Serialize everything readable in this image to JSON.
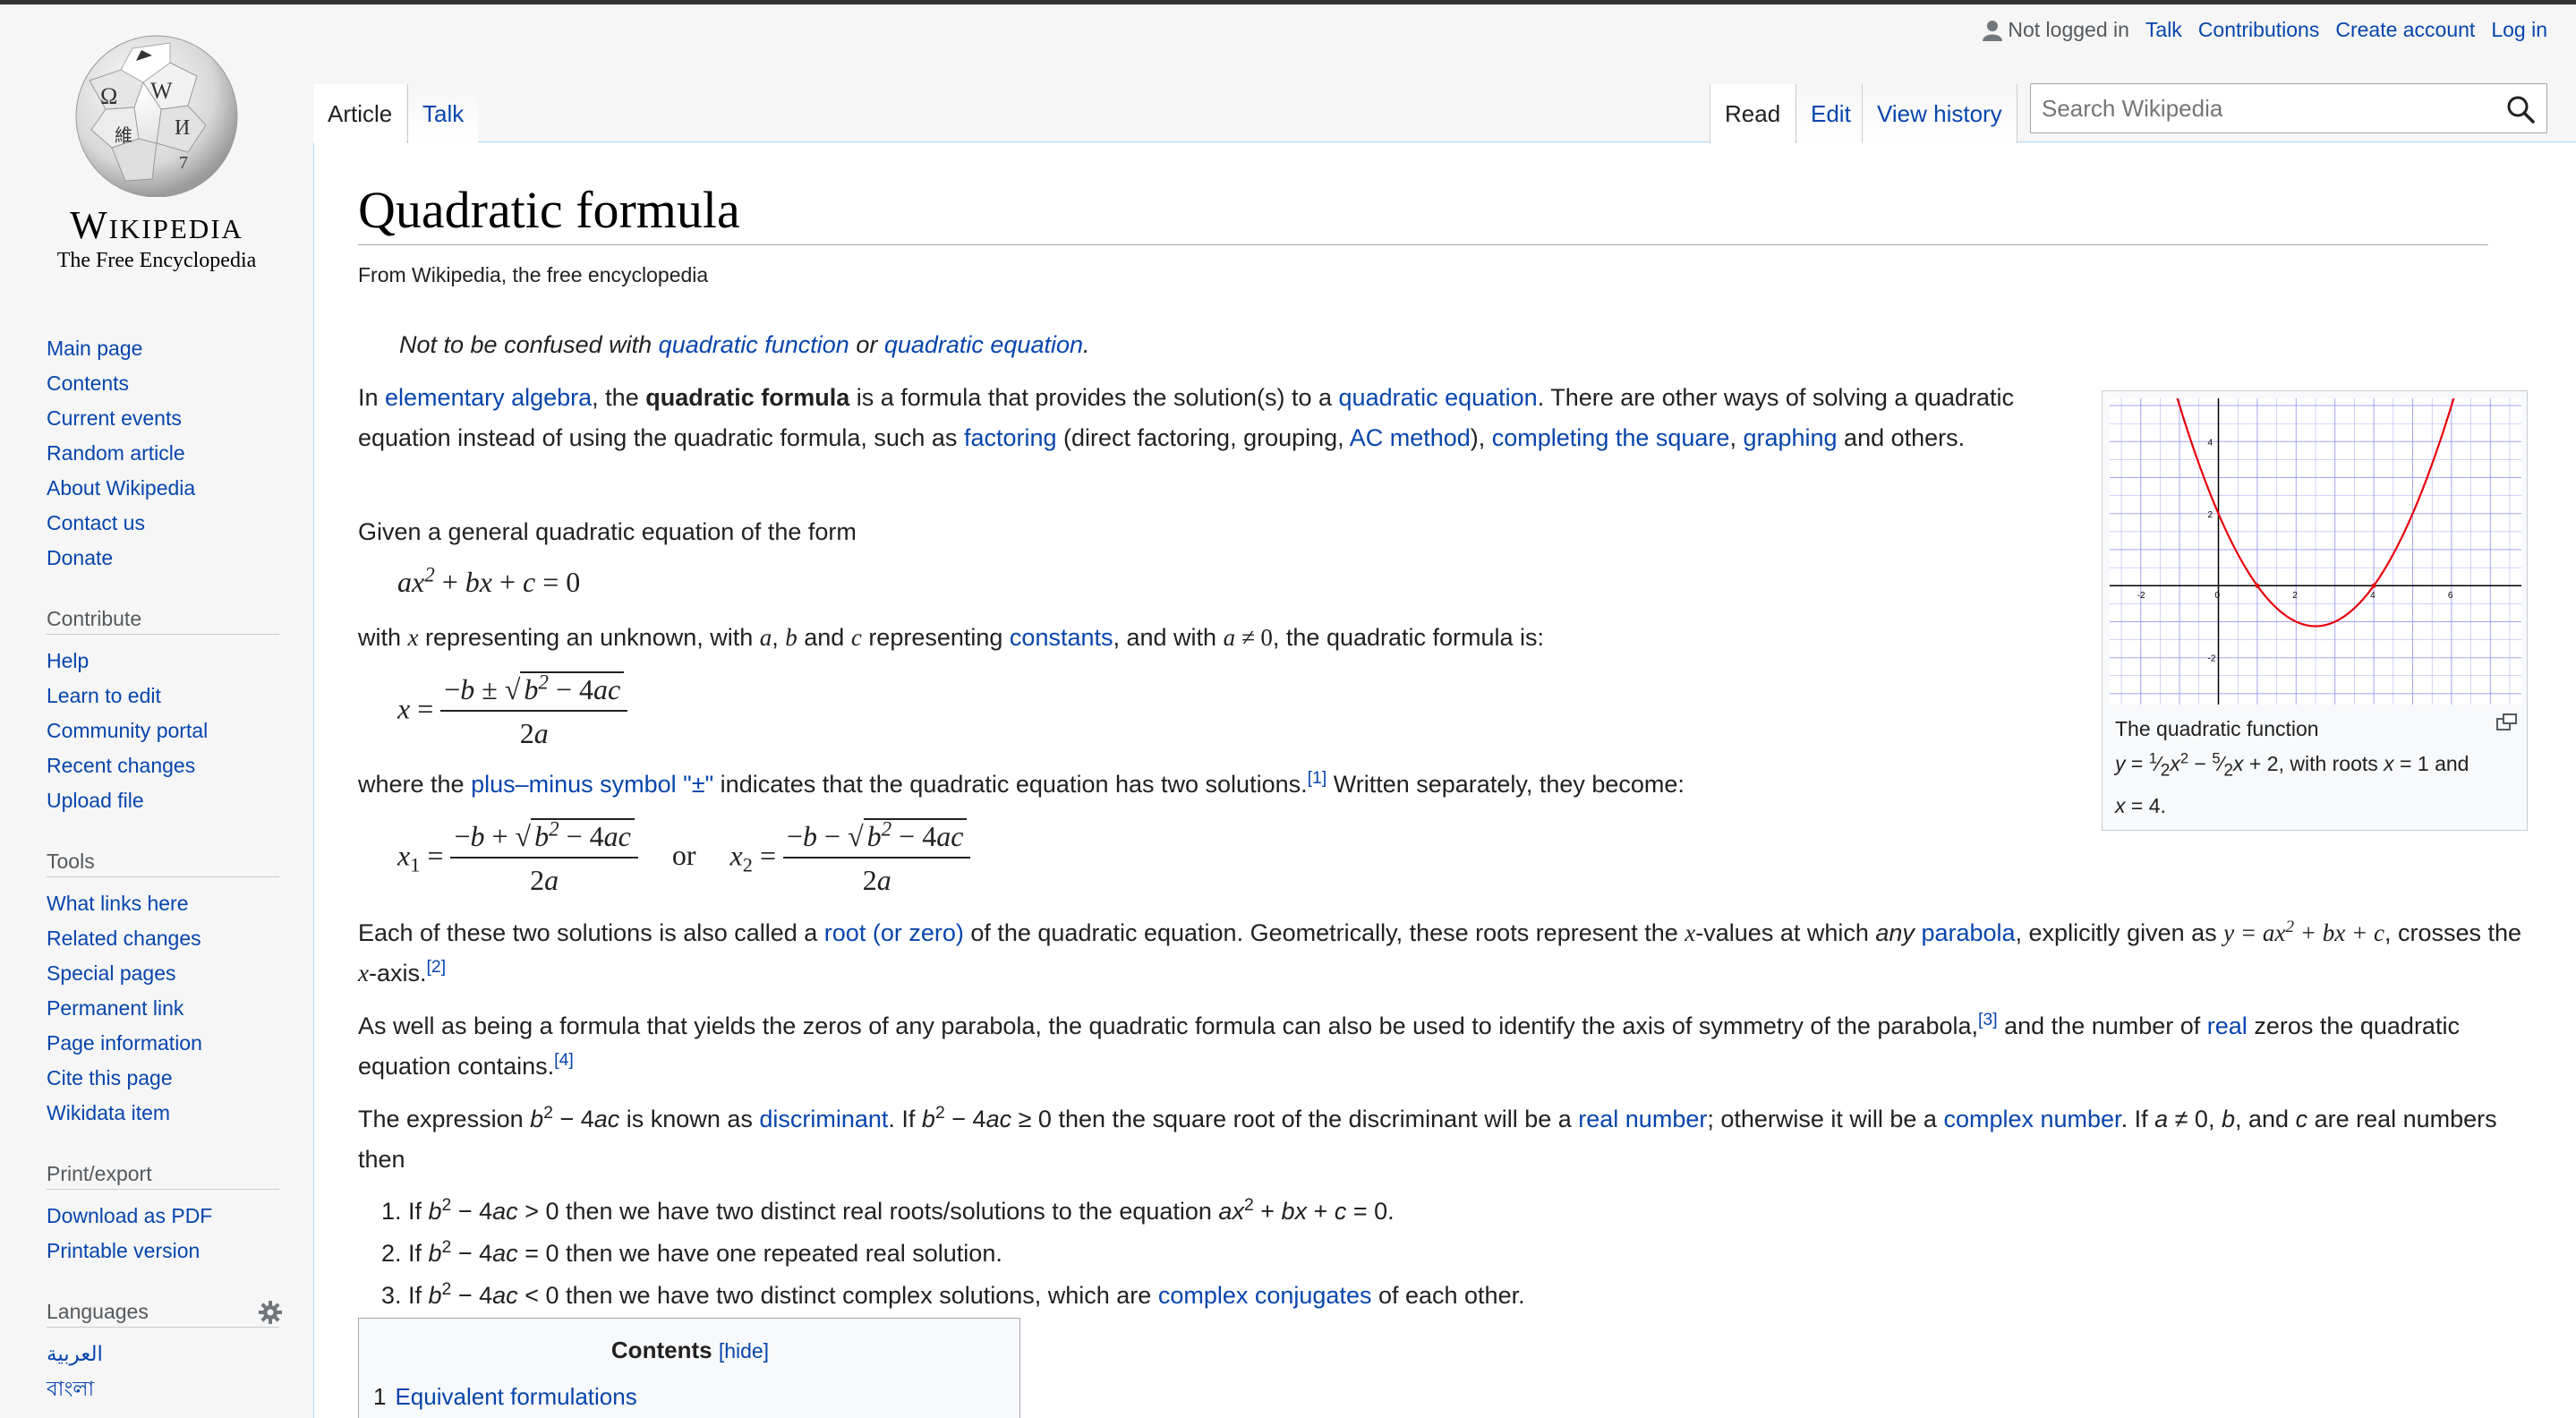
{
  "site": {
    "wordmark": "Wikipedia",
    "tagline": "The Free Encyclopedia"
  },
  "personal": {
    "not_logged": "Not logged in",
    "talk": "Talk",
    "contributions": "Contributions",
    "create_account": "Create account",
    "login": "Log in"
  },
  "tabs": {
    "article": "Article",
    "talk": "Talk",
    "read": "Read",
    "edit": "Edit",
    "history": "View history"
  },
  "search": {
    "placeholder": "Search Wikipedia"
  },
  "sidebar": {
    "nav": [
      "Main page",
      "Contents",
      "Current events",
      "Random article",
      "About Wikipedia",
      "Contact us",
      "Donate"
    ],
    "contribute_head": "Contribute",
    "contribute": [
      "Help",
      "Learn to edit",
      "Community portal",
      "Recent changes",
      "Upload file"
    ],
    "tools_head": "Tools",
    "tools": [
      "What links here",
      "Related changes",
      "Special pages",
      "Permanent link",
      "Page information",
      "Cite this page",
      "Wikidata item"
    ],
    "print_head": "Print/export",
    "print": [
      "Download as PDF",
      "Printable version"
    ],
    "languages_head": "Languages",
    "languages": [
      "العربية",
      "বাংলা"
    ]
  },
  "article": {
    "title": "Quadratic formula",
    "subtitle": "From Wikipedia, the free encyclopedia",
    "hatnote": {
      "pre": "Not to be confused with ",
      "link1": "quadratic function",
      "mid": " or ",
      "link2": "quadratic equation",
      "post": "."
    },
    "p1": {
      "t1": "In ",
      "l1": "elementary algebra",
      "t2": ", the ",
      "bold": "quadratic formula",
      "t3": " is a formula that provides the solution(s) to a ",
      "l2": "quadratic equation",
      "t4": ". There are other ways of solving a quadratic equation instead of using the quadratic formula, such as ",
      "l3": "factoring",
      "t5": " (direct factoring, grouping, ",
      "l4": "AC method",
      "t6": "), ",
      "l5": "completing the square",
      "t7": ", ",
      "l6": "graphing",
      "t8": " and others."
    },
    "p2": "Given a general quadratic equation of the form",
    "p3": {
      "t1": "with ",
      "t2": " representing an unknown, with ",
      "t3": " and ",
      "t4": " representing ",
      "l1": "constants",
      "t5": ", and with ",
      "t6": ", the quadratic formula is:"
    },
    "p4": {
      "t1": "where the ",
      "l1": "plus–minus symbol \"±\"",
      "t2": " indicates that the quadratic equation has two solutions.",
      "r1": "[1]",
      "t3": " Written separately, they become:"
    },
    "p5": {
      "t1": "Each of these two solutions is also called a ",
      "l1": "root (or zero)",
      "t2": " of the quadratic equation. Geometrically, these roots represent the ",
      "t3": "-values at which ",
      "em": "any",
      "l2": "parabola",
      "t4": ", explicitly given as ",
      "t5": ", crosses the ",
      "t6": "-axis.",
      "r1": "[2]"
    },
    "p6": {
      "t1": "As well as being a formula that yields the zeros of any parabola, the quadratic formula can also be used to identify the axis of symmetry of the parabola,",
      "r1": "[3]",
      "t2": " and the number of ",
      "l1": "real",
      "t3": " zeros the quadratic equation contains.",
      "r2": "[4]"
    },
    "p7": {
      "t1": " is known as ",
      "l1": "discriminant",
      "t2": ". If ",
      "t3": " then the square root of the discriminant will be a ",
      "l2": "real number",
      "t4": "; otherwise it will be a ",
      "l3": "complex number",
      "t5": ". If ",
      "t6": " and ",
      "t7": " are real numbers then"
    },
    "list": {
      "i1a": "If ",
      "i1b": " then we have two distinct real roots/solutions to the equation ",
      "i2a": "If ",
      "i2b": " then we have one repeated real solution.",
      "i3a": "If ",
      "i3b": " then we have two distinct complex solutions, which are ",
      "i3l": "complex conjugates",
      "i3c": " of each other."
    },
    "or_word": "or",
    "figure": {
      "caption_line1": "The quadratic function",
      "caption_rest": ", with roots ",
      "caption_and": " and"
    },
    "toc": {
      "title": "Contents",
      "toggle": "[hide]",
      "item1_num": "1",
      "item1": "Equivalent formulations"
    }
  },
  "chart_data": {
    "type": "line",
    "function": "y = 0.5x^2 - 2.5x + 2",
    "xlim": [
      -2.8,
      7.8
    ],
    "ylim": [
      -3.3,
      5.2
    ],
    "x_ticks": [
      "-2",
      "0",
      "2",
      "4",
      "6"
    ],
    "y_ticks": [
      "4",
      "2",
      "-2"
    ],
    "roots": [
      1,
      4
    ],
    "grid": true,
    "colors": {
      "curve": "#e8000b",
      "grid": "#8e8ef0",
      "axis": "#000000"
    }
  }
}
